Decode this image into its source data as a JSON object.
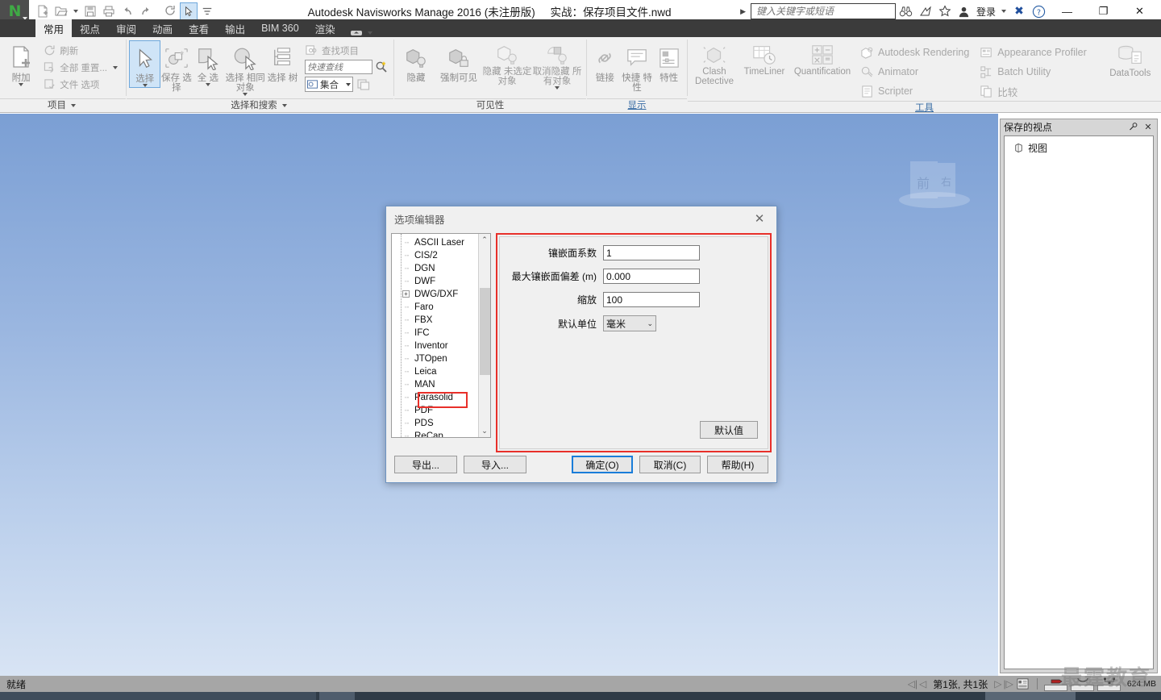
{
  "titlebar": {
    "logo_glyph": "N",
    "quick_access": [
      {
        "name": "new-document",
        "icon": "page-icon"
      },
      {
        "name": "open-document",
        "icon": "folder-open-icon"
      },
      {
        "name": "save-document",
        "icon": "floppy-disk-icon"
      },
      {
        "name": "print-document",
        "icon": "printer-icon"
      },
      {
        "name": "undo",
        "icon": "undo-arrow-icon"
      },
      {
        "name": "redo",
        "icon": "redo-arrow-icon"
      },
      {
        "name": "refresh",
        "icon": "refresh-icon"
      },
      {
        "name": "select",
        "icon": "cursor-arrow-icon"
      }
    ],
    "app_title": "Autodesk Navisworks Manage 2016 (未注册版)",
    "doc_title": "实战：保存项目文件.nwd",
    "search_placeholder": "键入关键字或短语",
    "search_value": "",
    "login_label": "登录",
    "window_buttons": {
      "minimize": "—",
      "maximize": "❐",
      "close": "✕"
    }
  },
  "tabs": [
    {
      "label": "常用",
      "active": true
    },
    {
      "label": "视点",
      "active": false
    },
    {
      "label": "审阅",
      "active": false
    },
    {
      "label": "动画",
      "active": false
    },
    {
      "label": "查看",
      "active": false
    },
    {
      "label": "输出",
      "active": false
    },
    {
      "label": "BIM 360",
      "active": false
    },
    {
      "label": "渲染",
      "active": false
    }
  ],
  "ribbon": {
    "panels": [
      {
        "title": "项目",
        "big_buttons": [
          {
            "label": "附加",
            "icon": "attach-file-icon"
          }
        ],
        "small_buttons": [
          {
            "label": "刷新",
            "icon": "refresh-icon"
          },
          {
            "label": "全部 重置...",
            "icon": "reset-all-icon"
          },
          {
            "label": "文件 选项",
            "icon": "file-options-icon"
          }
        ]
      },
      {
        "title": "选择和搜索",
        "big_buttons": [
          {
            "label": "选择",
            "icon": "cursor-arrow-icon",
            "selected": true
          },
          {
            "label": "保存 选择",
            "icon": "save-selection-icon"
          },
          {
            "label": "全 选",
            "icon": "select-all-icon"
          },
          {
            "label": "选择 相同对象",
            "icon": "select-same-icon"
          },
          {
            "label": "选择 树",
            "icon": "selection-tree-icon"
          }
        ],
        "find_label": "查找项目",
        "quickfind_placeholder": "快速查线",
        "sets_label": "集合"
      },
      {
        "title": "可见性",
        "big_buttons": [
          {
            "label": "隐藏",
            "icon": "hide-cube-icon"
          },
          {
            "label": "强制可见",
            "icon": "force-visible-icon"
          },
          {
            "label": "隐藏 未选定对象",
            "icon": "hide-unselected-icon"
          },
          {
            "label": "取消隐藏 所有对象",
            "icon": "unhide-all-icon"
          }
        ]
      },
      {
        "title": "显示",
        "big_buttons": [
          {
            "label": "链接",
            "icon": "link-icon"
          },
          {
            "label": "快捷 特性",
            "icon": "quick-properties-icon"
          },
          {
            "label": "特性",
            "icon": "properties-icon"
          }
        ]
      },
      {
        "title": "工具",
        "big_buttons": [
          {
            "label": "Clash Detective",
            "icon": "clash-detective-icon"
          },
          {
            "label": "TimeLiner",
            "icon": "timeliner-icon"
          },
          {
            "label": "Quantification",
            "icon": "quantification-icon"
          }
        ],
        "tool_items": [
          {
            "label": "Autodesk Rendering",
            "icon": "rendering-icon"
          },
          {
            "label": "Animator",
            "icon": "animator-icon"
          },
          {
            "label": "Scripter",
            "icon": "scripter-icon"
          },
          {
            "label": "Appearance Profiler",
            "icon": "appearance-profiler-icon"
          },
          {
            "label": "Batch Utility",
            "icon": "batch-utility-icon"
          },
          {
            "label": "比较",
            "icon": "compare-icon"
          }
        ],
        "datatools_label": "DataTools"
      }
    ]
  },
  "viewport": {
    "viewcube": {
      "front_label": "前",
      "right_label": "右"
    },
    "navbar_tools": [
      {
        "name": "steering-wheel-icon"
      },
      {
        "name": "pan-hand-icon"
      },
      {
        "name": "zoom-window-icon"
      },
      {
        "name": "orbit-icon"
      },
      {
        "name": "look-around-icon"
      },
      {
        "name": "walk-icon"
      },
      {
        "name": "select-arrow-icon"
      }
    ]
  },
  "dock": {
    "title": "保存的视点",
    "pin_icon": "pin-icon",
    "close_icon": "close-icon",
    "items": [
      {
        "label": "视图",
        "icon": "viewpoint-cube-icon"
      }
    ]
  },
  "statusbar": {
    "ready_text": "就绪",
    "page_text": "第1张, 共1张",
    "memory_text": "624 MB",
    "progress": [
      {
        "name": "drawing-progress",
        "percent": 100
      },
      {
        "name": "memory-progress",
        "percent": 86
      },
      {
        "name": "data-progress",
        "percent": 0
      }
    ]
  },
  "watermark": "最霆教育",
  "dialog": {
    "title": "选项编辑器",
    "close_icon": "close-icon",
    "tree_items": [
      {
        "label": "ASCII Laser",
        "expandable": false,
        "selected": false
      },
      {
        "label": "CIS/2",
        "expandable": false,
        "selected": false
      },
      {
        "label": "DGN",
        "expandable": false,
        "selected": false
      },
      {
        "label": "DWF",
        "expandable": false,
        "selected": false
      },
      {
        "label": "DWG/DXF",
        "expandable": true,
        "selected": false
      },
      {
        "label": "Faro",
        "expandable": false,
        "selected": false
      },
      {
        "label": "FBX",
        "expandable": false,
        "selected": false
      },
      {
        "label": "IFC",
        "expandable": false,
        "selected": false
      },
      {
        "label": "Inventor",
        "expandable": false,
        "selected": false
      },
      {
        "label": "JTOpen",
        "expandable": false,
        "selected": false
      },
      {
        "label": "Leica",
        "expandable": false,
        "selected": false
      },
      {
        "label": "MAN",
        "expandable": false,
        "selected": false
      },
      {
        "label": "Parasolid",
        "expandable": false,
        "selected": true
      },
      {
        "label": "PDF",
        "expandable": false,
        "selected": false
      },
      {
        "label": "PDS",
        "expandable": false,
        "selected": false
      },
      {
        "label": "ReCap",
        "expandable": false,
        "selected": false
      }
    ],
    "fields": [
      {
        "label": "镶嵌面系数",
        "value": "1",
        "type": "text"
      },
      {
        "label": "最大镶嵌面偏差 (m)",
        "value": "0.000",
        "type": "text"
      },
      {
        "label": "缩放",
        "value": "100",
        "type": "text"
      },
      {
        "label": "默认单位",
        "value": "毫米",
        "type": "select"
      }
    ],
    "default_button": "默认值",
    "export_button": "导出...",
    "import_button": "导入...",
    "ok_button": "确定(O)",
    "cancel_button": "取消(C)",
    "help_button": "帮助(H)",
    "highlight_color": "#e8302a"
  }
}
